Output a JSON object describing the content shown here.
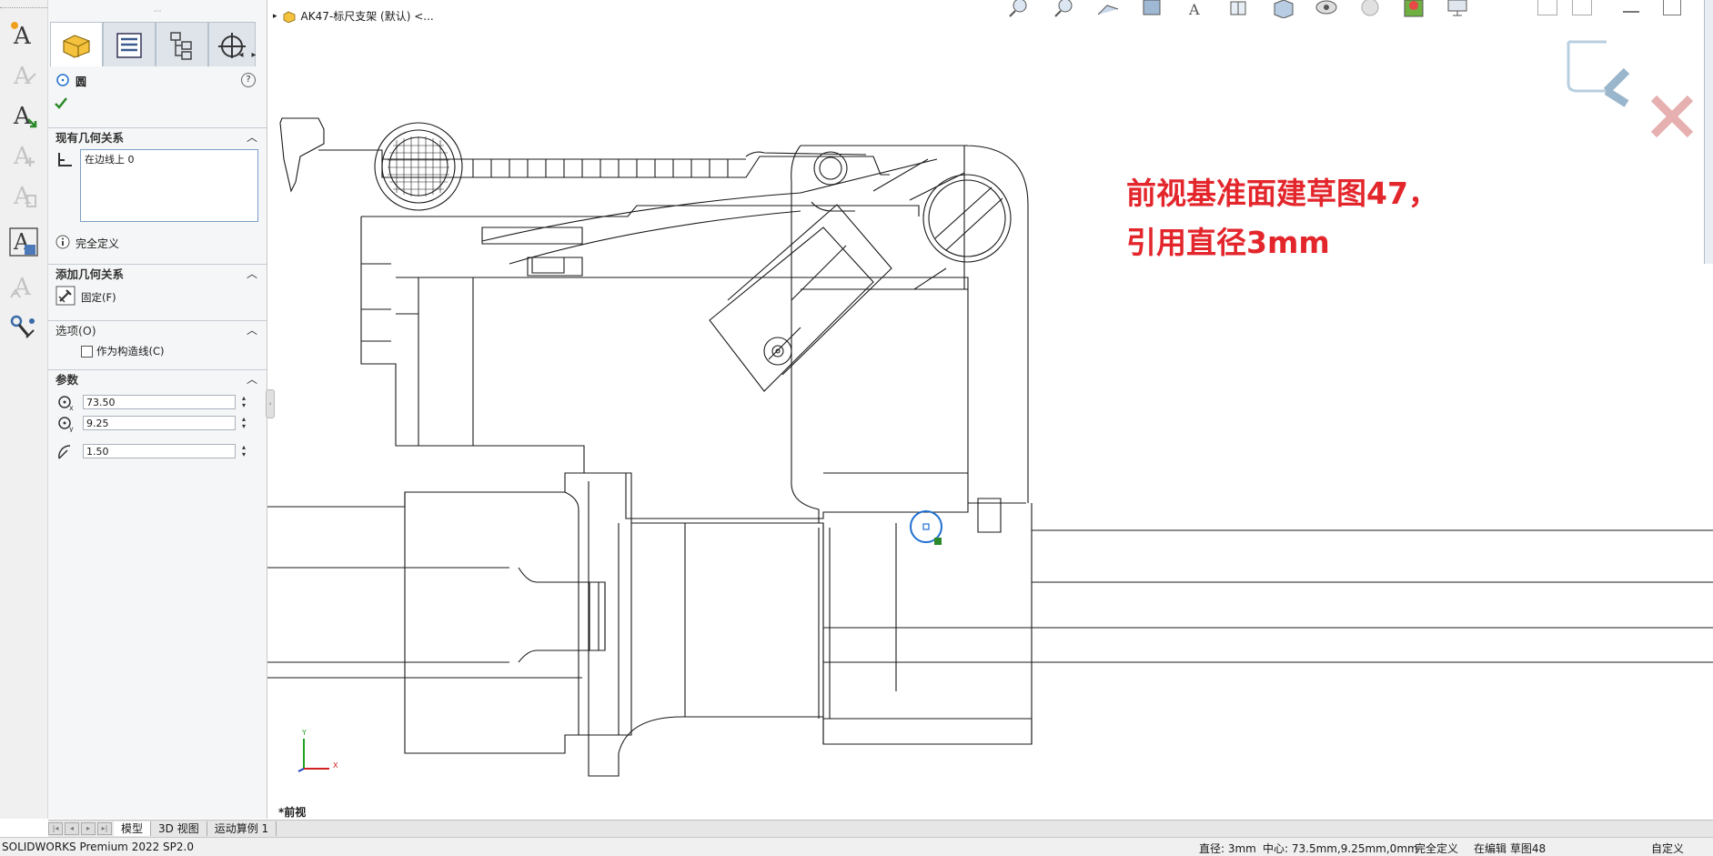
{
  "document": {
    "breadcrumb": "AK47-标尺支架 (默认) <...",
    "view_name": "*前视"
  },
  "property_manager": {
    "feature_title": "圆",
    "help_label": "?",
    "existing_relations": {
      "header": "现有几何关系",
      "items": [
        "在边线上 0"
      ],
      "status": "完全定义"
    },
    "add_relations": {
      "header": "添加几何关系",
      "fix_label": "固定(F)"
    },
    "options": {
      "header": "选项(O)",
      "construction_label": "作为构造线(C)",
      "construction_checked": false
    },
    "parameters": {
      "header": "参数",
      "center_x": "73.50",
      "center_y": "9.25",
      "radius": "1.50"
    }
  },
  "annotation": {
    "line1": "前视基准面建草图47，",
    "line2": "引用直径3mm",
    "color": "#e3262c"
  },
  "bottom_tabs": [
    "模型",
    "3D 视图",
    "运动算例 1"
  ],
  "status_bar": {
    "product": "SOLIDWORKS Premium 2022 SP2.0",
    "diameter": "直径: 3mm",
    "center": "中心: 73.5mm,9.25mm,0mm",
    "definition": "完全定义",
    "editing": "在编辑 草图48",
    "units": "自定义"
  },
  "colors": {
    "accent_blue": "#1f6fd0",
    "ok_green": "#2a8a2a",
    "triad_x": "#d02020",
    "triad_y": "#20a020"
  }
}
